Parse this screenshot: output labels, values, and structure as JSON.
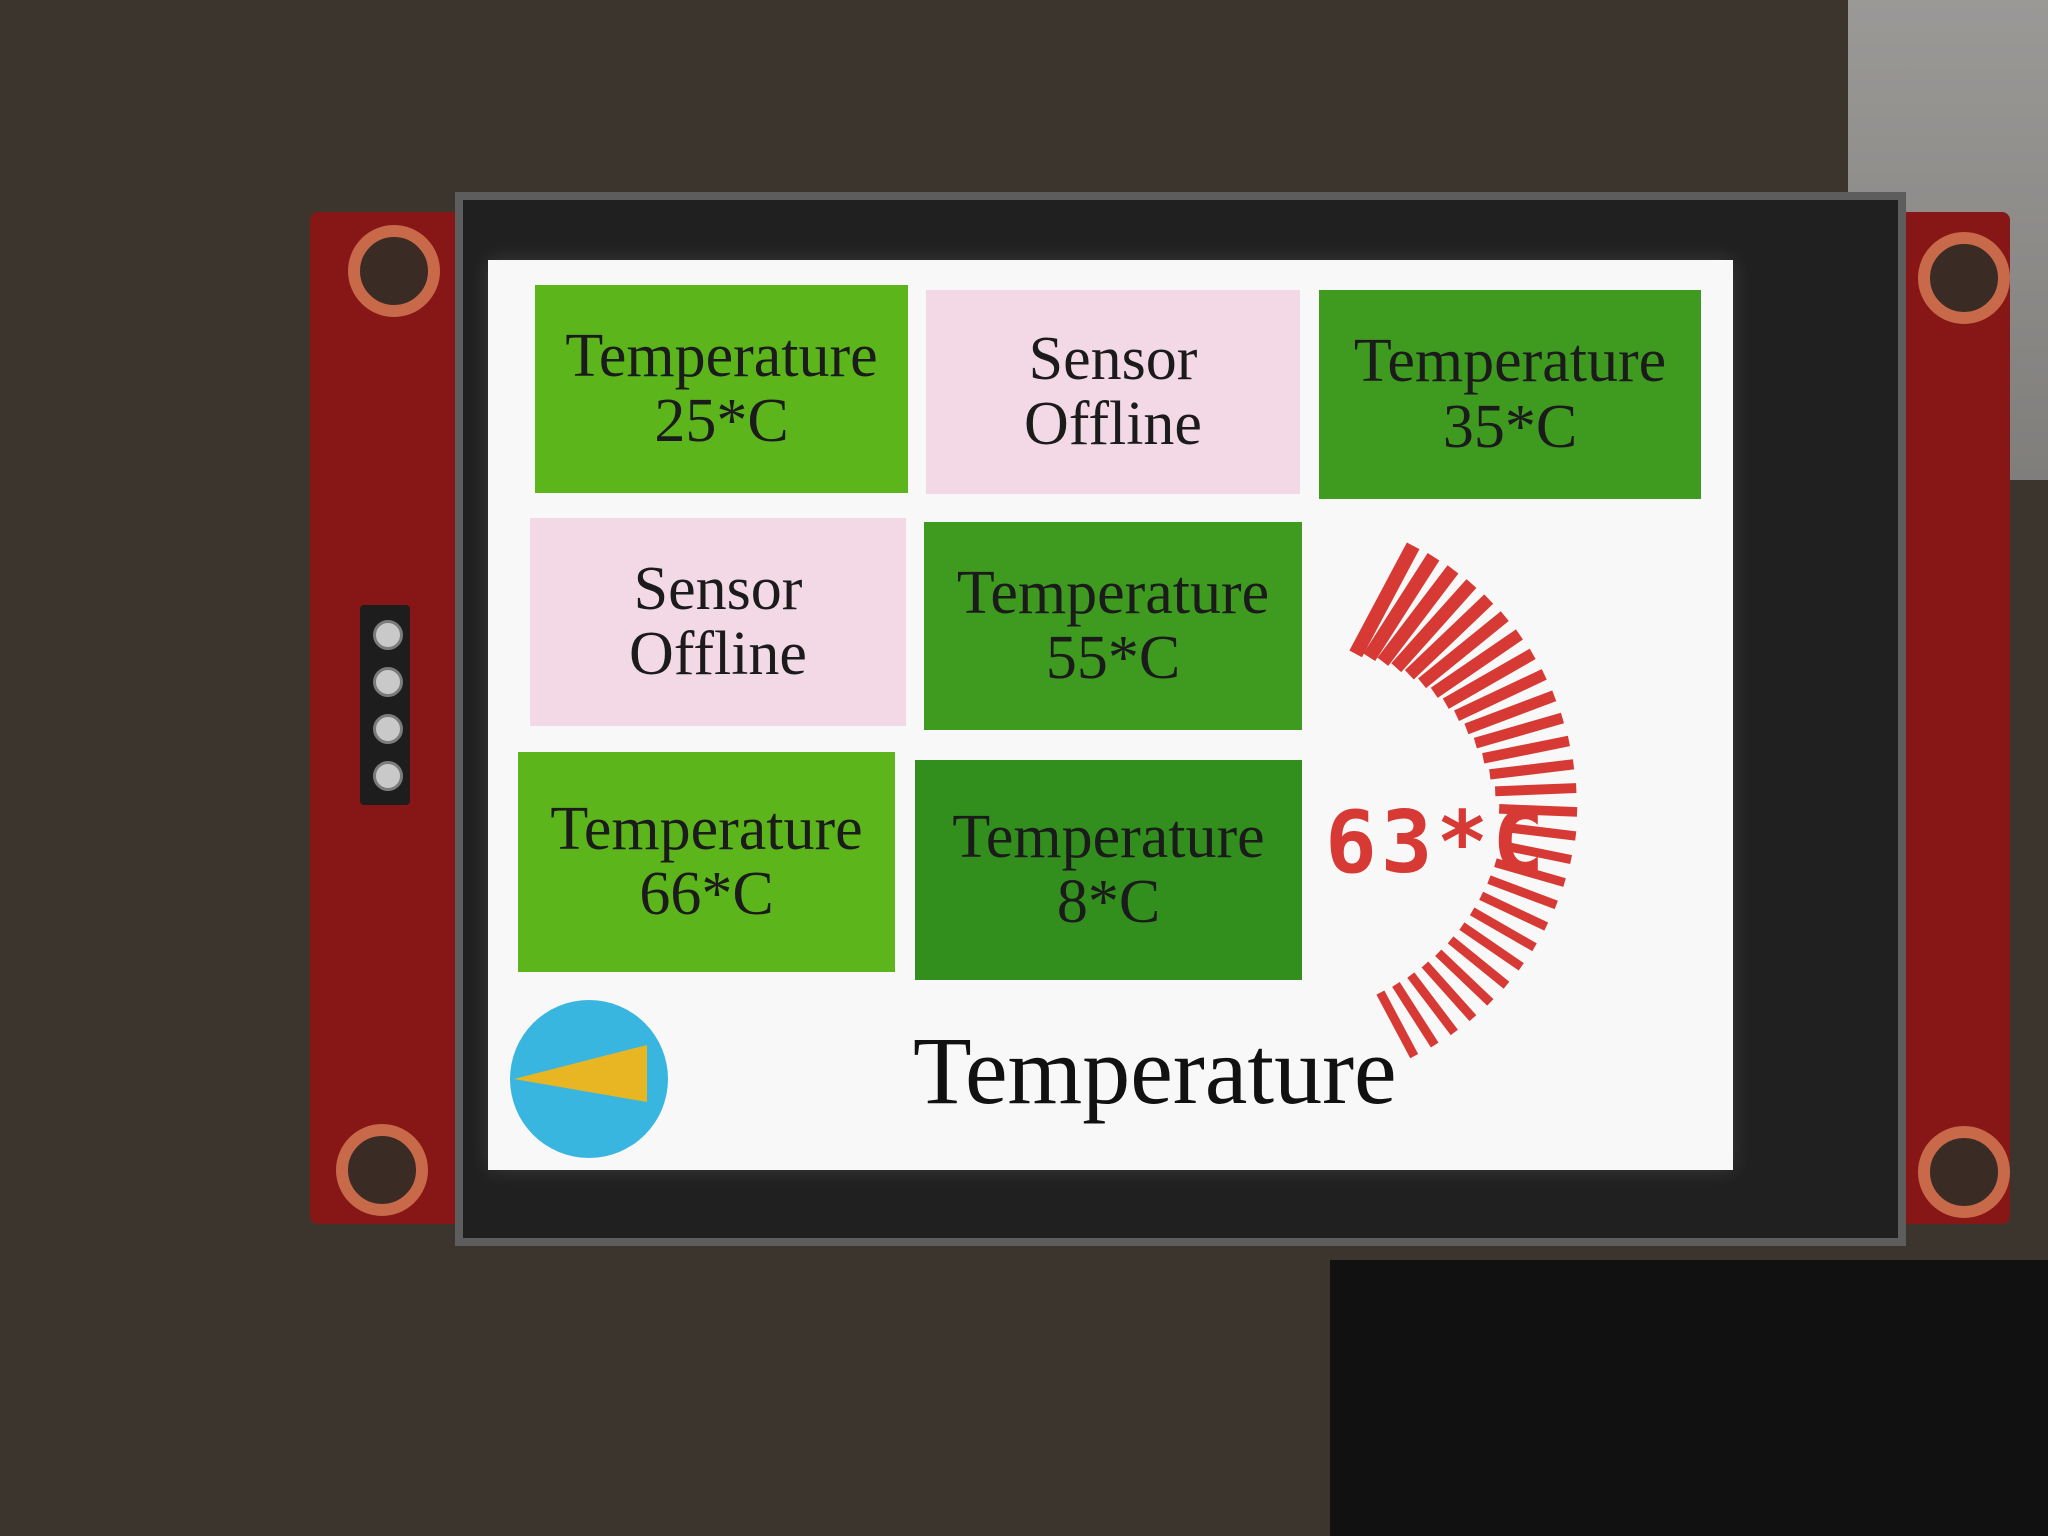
{
  "colors": {
    "tile_bright": "#5db51c",
    "tile_mid": "#3f9b20",
    "tile_dark": "#338f1d",
    "tile_offline": "#f3d9e6",
    "gauge": "#d73a34",
    "pie_circle": "#39b6df",
    "pie_slice": "#e9b623"
  },
  "tiles": [
    {
      "line1": "Temperature",
      "line2": "25*C"
    },
    {
      "line1": "Sensor",
      "line2": "Offline"
    },
    {
      "line1": "Temperature",
      "line2": "35*C"
    },
    {
      "line1": "Sensor",
      "line2": "Offline"
    },
    {
      "line1": "Temperature",
      "line2": "55*C"
    },
    {
      "line1": "Temperature",
      "line2": "66*C"
    },
    {
      "line1": "Temperature",
      "line2": "8*C"
    }
  ],
  "gauge": {
    "value": 63,
    "unit": "°C",
    "readout": "63*C"
  },
  "label": "Temperature",
  "icons": [
    "pie-icon",
    "gauge-arc-icon"
  ]
}
